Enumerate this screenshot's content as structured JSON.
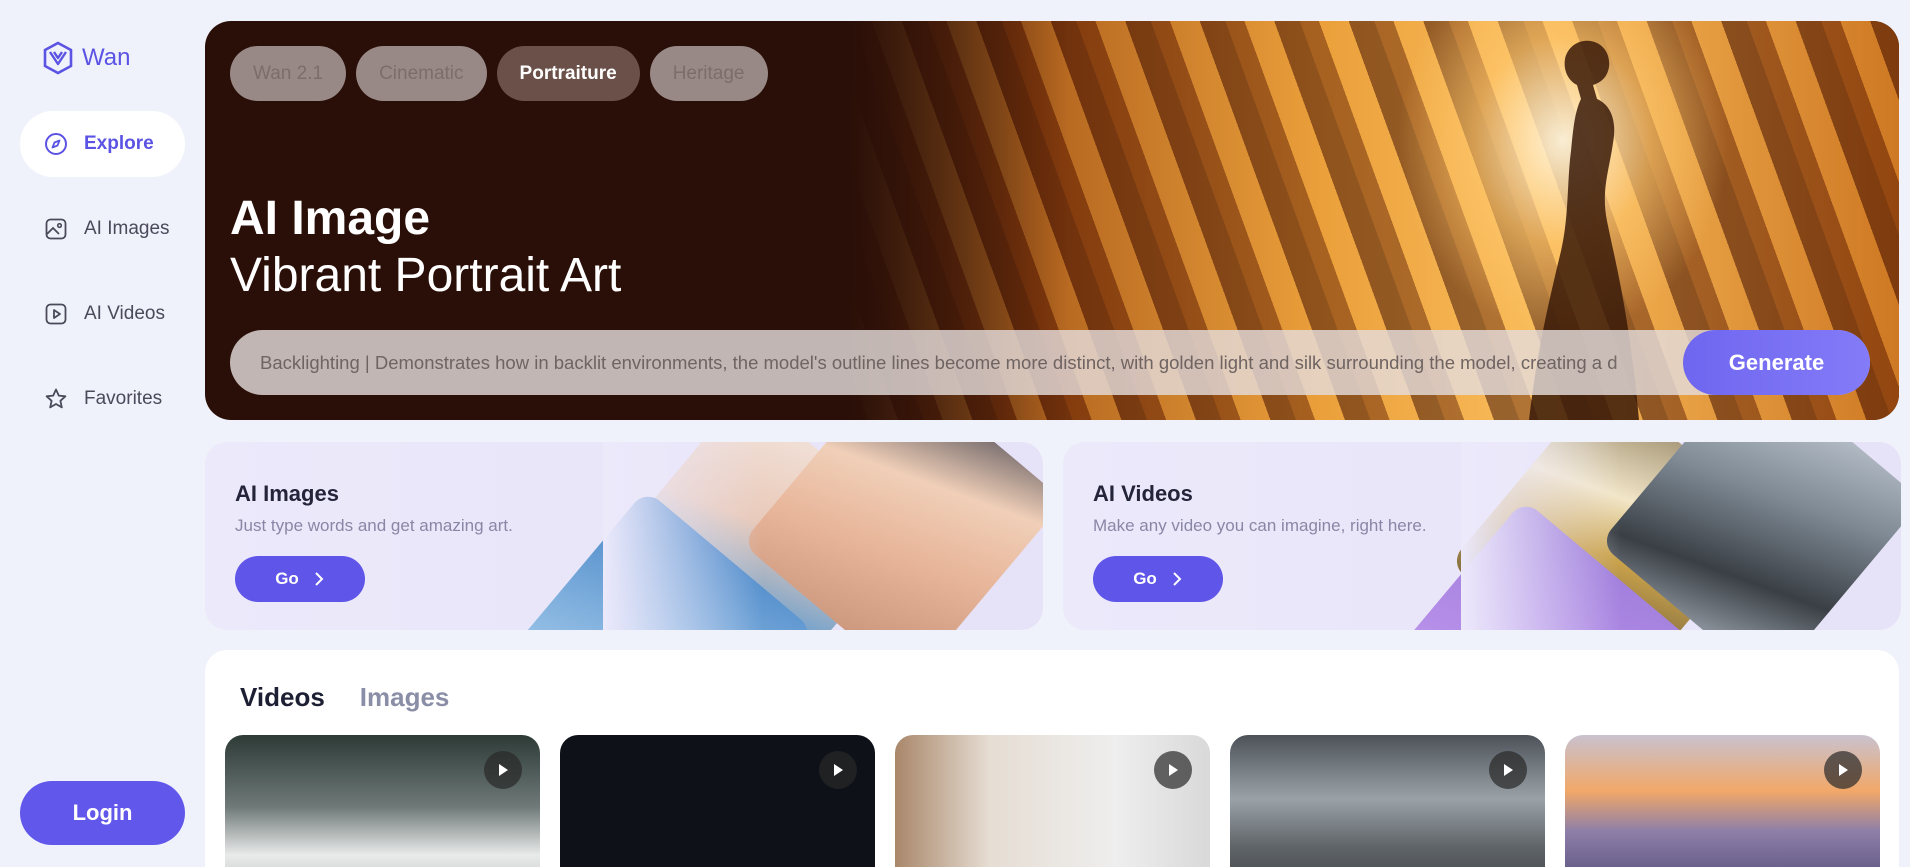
{
  "brand": {
    "name": "Wan"
  },
  "sidebar": {
    "items": [
      {
        "label": "Explore",
        "icon": "compass-icon",
        "active": true
      },
      {
        "label": "AI Images",
        "icon": "image-icon",
        "active": false
      },
      {
        "label": "AI Videos",
        "icon": "video-play-icon",
        "active": false
      },
      {
        "label": "Favorites",
        "icon": "star-icon",
        "active": false
      }
    ],
    "login_label": "Login"
  },
  "hero": {
    "chips": [
      {
        "label": "Wan 2.1",
        "active": false
      },
      {
        "label": "Cinematic",
        "active": false
      },
      {
        "label": "Portraiture",
        "active": true
      },
      {
        "label": "Heritage",
        "active": false
      }
    ],
    "title": "AI Image",
    "subtitle": "Vibrant Portrait Art",
    "prompt": "Backlighting | Demonstrates how in backlit environments, the model's outline lines become more distinct, with golden light and silk surrounding the model, creating a d",
    "generate_label": "Generate"
  },
  "cards": [
    {
      "title": "AI Images",
      "description": "Just type words and get amazing art.",
      "button_label": "Go"
    },
    {
      "title": "AI Videos",
      "description": "Make any video you can imagine, right here.",
      "button_label": "Go"
    }
  ],
  "gallery": {
    "tabs": [
      {
        "label": "Videos",
        "active": true
      },
      {
        "label": "Images",
        "active": false
      }
    ]
  },
  "colors": {
    "accent": "#5b53e3",
    "button": "#6157ea",
    "page_bg": "#f0f2fb",
    "hero_bg": "#2a0f08"
  }
}
